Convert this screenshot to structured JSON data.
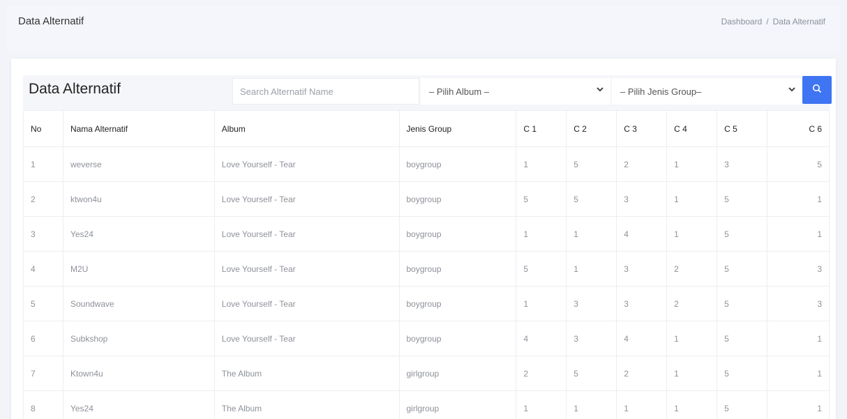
{
  "header": {
    "title": "Data Alternatif",
    "breadcrumb": {
      "home": "Dashboard",
      "separator": "/",
      "current": "Data Alternatif"
    }
  },
  "card": {
    "title": "Data Alternatif",
    "search": {
      "placeholder": "Search Alternatif Name",
      "value": ""
    },
    "album_select": {
      "selected": "– Pilih Album –"
    },
    "group_select": {
      "selected": "– Pilih Jenis Group–"
    },
    "search_button_icon": "search-icon",
    "accent_color": "#3f74f3"
  },
  "table": {
    "columns": [
      "No",
      "Nama Alternatif",
      "Album",
      "Jenis Group",
      "C 1",
      "C 2",
      "C 3",
      "C 4",
      "C 5",
      "C 6"
    ],
    "rows": [
      [
        "1",
        "weverse",
        "Love Yourself - Tear",
        "boygroup",
        "1",
        "5",
        "2",
        "1",
        "3",
        "5"
      ],
      [
        "2",
        "ktwon4u",
        "Love Yourself - Tear",
        "boygroup",
        "5",
        "5",
        "3",
        "1",
        "5",
        "1"
      ],
      [
        "3",
        "Yes24",
        "Love Yourself - Tear",
        "boygroup",
        "1",
        "1",
        "4",
        "1",
        "5",
        "1"
      ],
      [
        "4",
        "M2U",
        "Love Yourself - Tear",
        "boygroup",
        "5",
        "1",
        "3",
        "2",
        "5",
        "3"
      ],
      [
        "5",
        "Soundwave",
        "Love Yourself - Tear",
        "boygroup",
        "1",
        "3",
        "3",
        "2",
        "5",
        "3"
      ],
      [
        "6",
        "Subkshop",
        "Love Yourself - Tear",
        "boygroup",
        "4",
        "3",
        "4",
        "1",
        "5",
        "1"
      ],
      [
        "7",
        "Ktown4u",
        "The Album",
        "girlgroup",
        "2",
        "5",
        "2",
        "1",
        "5",
        "1"
      ],
      [
        "8",
        "Yes24",
        "The Album",
        "girlgroup",
        "1",
        "1",
        "1",
        "1",
        "5",
        "1"
      ]
    ]
  }
}
